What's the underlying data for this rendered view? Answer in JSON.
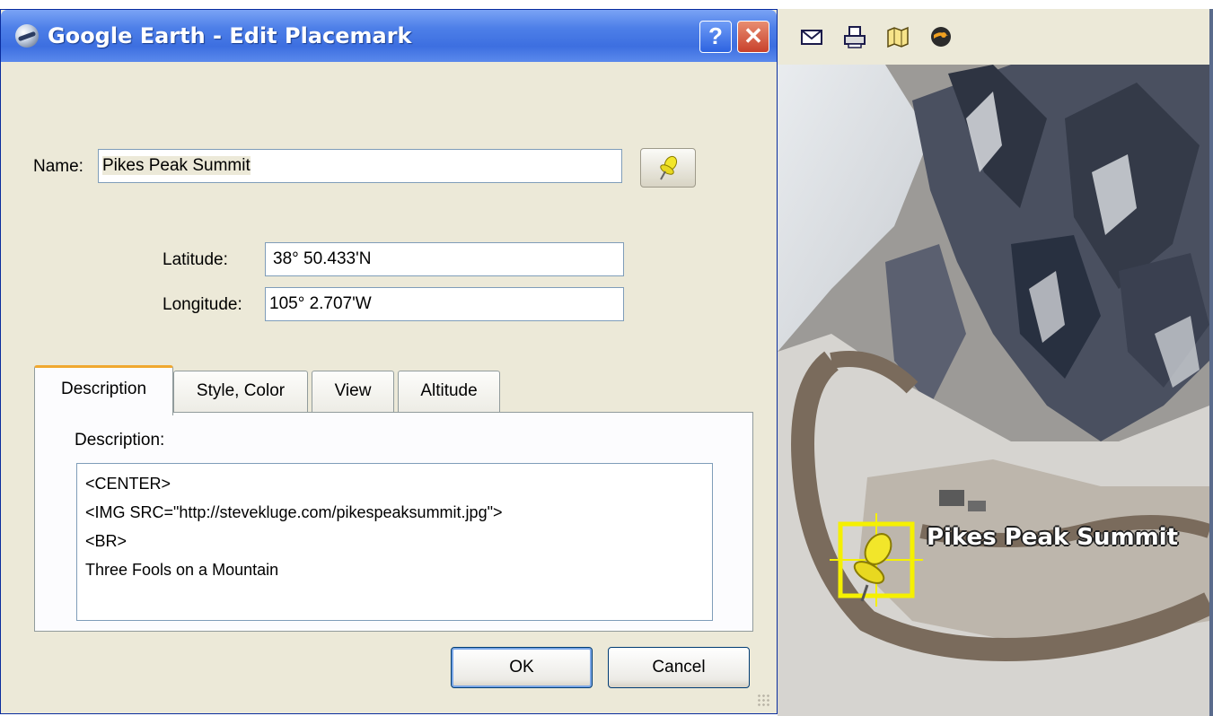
{
  "dialog": {
    "title": "Google Earth - Edit Placemark",
    "help_label": "?",
    "close_label": "✕",
    "name_label": "Name:",
    "name_value": "Pikes Peak Summit",
    "latitude_label": "Latitude:",
    "latitude_value": "38° 50.433'N",
    "longitude_label": "Longitude:",
    "longitude_value": "105° 2.707'W",
    "tabs": [
      {
        "label": "Description",
        "active": true
      },
      {
        "label": "Style, Color",
        "active": false
      },
      {
        "label": "View",
        "active": false
      },
      {
        "label": "Altitude",
        "active": false
      }
    ],
    "description_label": "Description:",
    "description_lines": [
      "<CENTER>",
      "<IMG SRC=\"http://stevekluge.com/pikespeaksummit.jpg\">",
      "<BR>",
      "Three Fools on a Mountain"
    ],
    "ok_label": "OK",
    "cancel_label": "Cancel"
  },
  "map": {
    "toolbar": [
      "email-icon",
      "print-icon",
      "map-icon",
      "google-maps-icon"
    ],
    "placemark_label": "Pikes Peak Summit",
    "colors": {
      "placemark_highlight": "#f5f000",
      "pin": "#f2e62a"
    }
  }
}
